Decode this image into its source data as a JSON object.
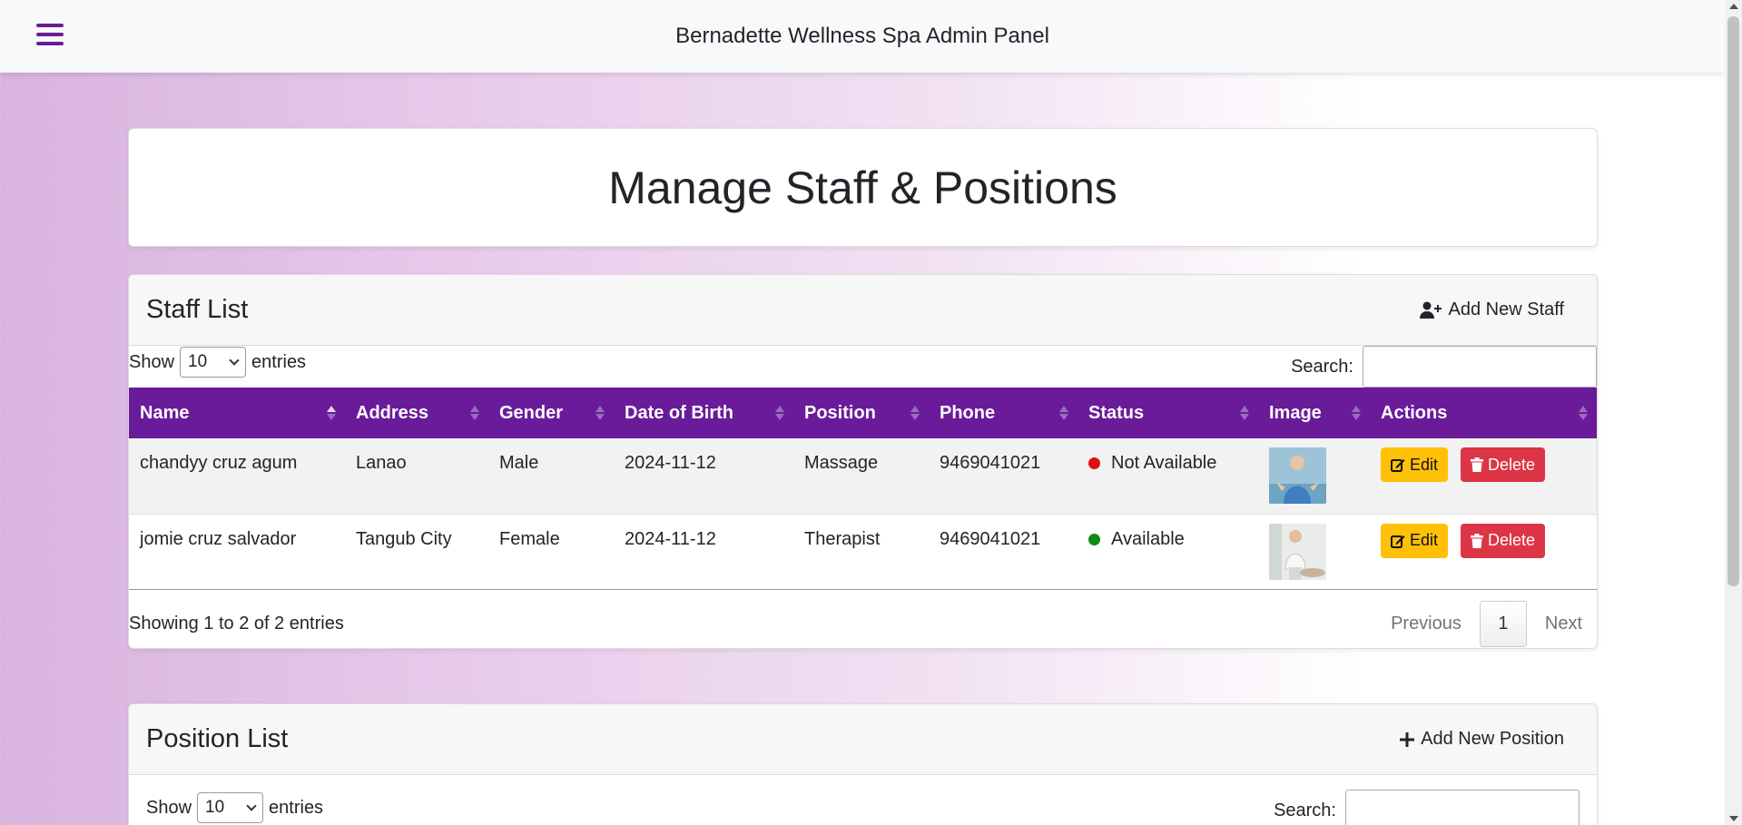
{
  "topbar": {
    "title": "Bernadette Wellness Spa Admin Panel",
    "menu_icon": "hamburger-menu-icon"
  },
  "page": {
    "title": "Manage Staff & Positions"
  },
  "staff": {
    "title": "Staff List",
    "add_label": "Add New Staff",
    "show_label": "Show",
    "entries_value": "10",
    "entries_label": "entries",
    "search_label": "Search:",
    "search_value": "",
    "columns": [
      "Name",
      "Address",
      "Gender",
      "Date of Birth",
      "Position",
      "Phone",
      "Status",
      "Image",
      "Actions"
    ],
    "rows": [
      {
        "name": "chandyy cruz agum",
        "address": "Lanao",
        "gender": "Male",
        "dob": "2024-11-12",
        "position": "Massage",
        "phone": "9469041021",
        "status": "Not Available",
        "status_color": "#e01010",
        "edit": "Edit",
        "delete": "Delete"
      },
      {
        "name": "jomie cruz salvador",
        "address": "Tangub City",
        "gender": "Female",
        "dob": "2024-11-12",
        "position": "Therapist",
        "phone": "9469041021",
        "status": "Available",
        "status_color": "#128a12",
        "edit": "Edit",
        "delete": "Delete"
      }
    ],
    "info": "Showing 1 to 2 of 2 entries",
    "pager": {
      "previous": "Previous",
      "current": "1",
      "next": "Next"
    }
  },
  "positions": {
    "title": "Position List",
    "add_label": "Add New Position",
    "show_label": "Show",
    "entries_value": "10",
    "entries_label": "entries",
    "search_label": "Search:",
    "search_value": ""
  },
  "colors": {
    "accent": "#6a1b9a",
    "edit": "#ffc107",
    "delete": "#dc3545"
  }
}
